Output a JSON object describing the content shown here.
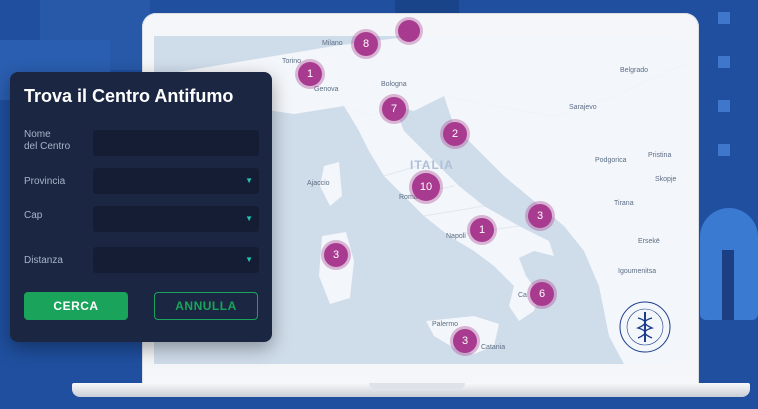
{
  "colors": {
    "background": "#1f4f9e",
    "panel": "#1b2742",
    "field": "#141d33",
    "primary_button": "#1aa45b",
    "cluster_marker": "#a83b8f",
    "map_sea": "#cfdcea",
    "map_land": "#f3f6fa"
  },
  "form": {
    "title": "Trova il Centro Antifumo",
    "nome_label_line1": "Nome",
    "nome_label_line2": "del Centro",
    "provincia_label": "Provincia",
    "cap_label": "Cap",
    "distanza_label": "Distanza",
    "cerca_button": "CERCA",
    "annulla_button": "ANNULLA"
  },
  "map": {
    "country_label": "ITALIA",
    "cities": {
      "milano": "Milano",
      "torino": "Torino",
      "genova": "Genova",
      "bologna": "Bologna",
      "roma": "Roma",
      "napoli": "Napoli",
      "palermo": "Palermo",
      "catania": "Catania",
      "ajaccio": "Ajaccio",
      "belgrado": "Belgrado",
      "sarajevo": "Sarajevo",
      "podgorica": "Podgorica",
      "pristina": "Pristina",
      "skopje": "Skopje",
      "tirana": "Tirana",
      "ersekë": "Ersekë",
      "igoumenitsa": "Igoumenitsa",
      "calabria_partial": "Ca"
    },
    "clusters": {
      "milano": "8",
      "torino": "1",
      "bologna": "7",
      "marche": "2",
      "roma": "10",
      "napoli": "1",
      "puglia": "3",
      "sardegna": "3",
      "calabria": "6",
      "sicilia": "3"
    },
    "seal_icon": "istituto-superiore-di-sanita-seal-icon"
  }
}
